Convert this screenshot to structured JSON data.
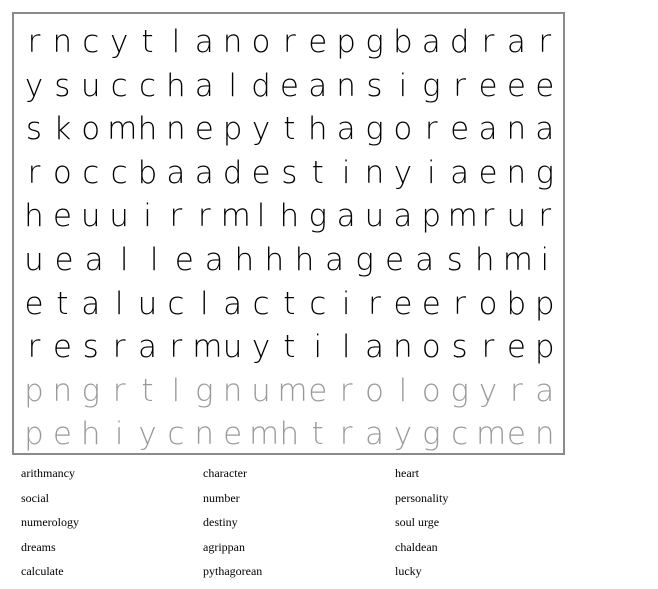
{
  "puzzle": {
    "rows": [
      "rncytlanorepgbadrar",
      "ysucchaldeansigreee",
      "skomhnepythagoreana",
      "roccbaadestinyiaeng",
      "heuuirrmlhgauapmrur",
      "uealleahhhageashmi",
      "etaluclactcireerobp",
      "resrarmuytilanosrep",
      "pngrtlgnumerologyra",
      "pehiycnemhtraygcmen"
    ],
    "faded_rows": [
      8,
      9
    ]
  },
  "word_list": {
    "columns": [
      [
        "arithmancy",
        "social",
        "numerology",
        "dreams",
        "calculate"
      ],
      [
        "character",
        "number",
        "destiny",
        "agrippan",
        "pythagorean"
      ],
      [
        "heart",
        "personality",
        "soul urge",
        "chaldean",
        "lucky"
      ]
    ]
  }
}
